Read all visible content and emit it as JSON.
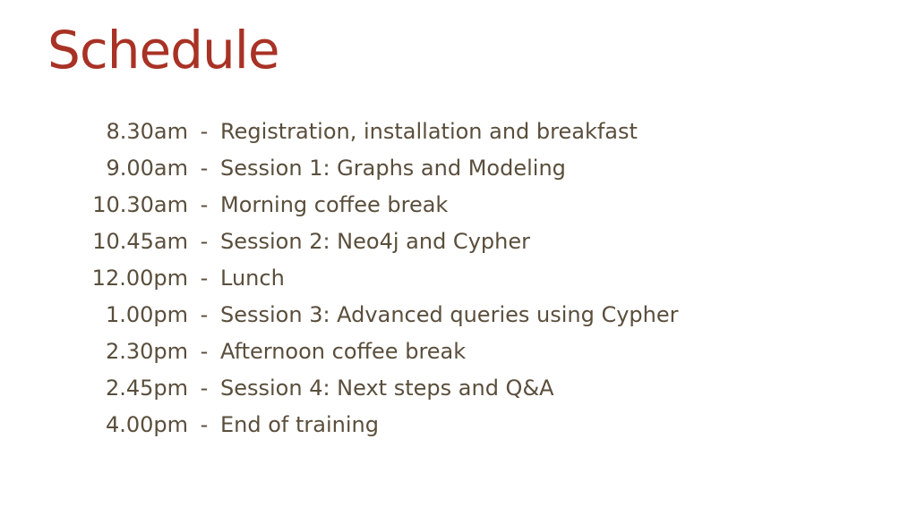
{
  "slide": {
    "title": "Schedule",
    "title_color": "#a83225",
    "text_color": "#5a4e3c",
    "separator": "-",
    "items": [
      {
        "time": "8.30am",
        "event": "Registration, installation and breakfast"
      },
      {
        "time": "9.00am",
        "event": "Session 1: Graphs and Modeling"
      },
      {
        "time": "10.30am",
        "event": "Morning coffee break"
      },
      {
        "time": "10.45am",
        "event": "Session 2: Neo4j and Cypher"
      },
      {
        "time": "12.00pm",
        "event": "Lunch"
      },
      {
        "time": "1.00pm",
        "event": "Session 3: Advanced queries using Cypher"
      },
      {
        "time": "2.30pm",
        "event": "Afternoon coffee break"
      },
      {
        "time": "2.45pm",
        "event": "Session 4: Next steps and Q&A"
      },
      {
        "time": "4.00pm",
        "event": "End of training"
      }
    ]
  }
}
